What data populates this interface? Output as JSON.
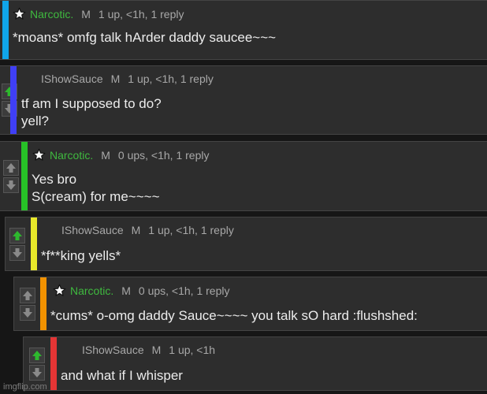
{
  "icons": {
    "upvote": "up-arrow-icon",
    "downvote": "down-arrow-icon",
    "star": "star-icon"
  },
  "colors": {
    "upvote_active": "#2eb82e",
    "upvote_inactive": "#8a8a8a",
    "downvote": "#8a8a8a",
    "username_green": "#3fb93f",
    "thread_colors": [
      "#10a5ea",
      "#3f3ff5",
      "#27c227",
      "#e8e82a",
      "#f29200",
      "#e53535"
    ]
  },
  "comments": [
    {
      "username": "Narcotic.",
      "badge": "M",
      "meta": "1 up, <1h, 1 reply",
      "lines": [
        "*moans* omfg talk hArder daddy saucee~~~"
      ]
    },
    {
      "username": "IShowSauce",
      "badge": "M",
      "meta": "1 up, <1h, 1 reply",
      "lines": [
        "tf am I supposed to do?",
        "yell?"
      ]
    },
    {
      "username": "Narcotic.",
      "badge": "M",
      "meta": "0 ups, <1h, 1 reply",
      "lines": [
        "Yes bro",
        "S(cream) for me~~~~"
      ]
    },
    {
      "username": "IShowSauce",
      "badge": "M",
      "meta": "1 up, <1h, 1 reply",
      "lines": [
        "*f**king yells*"
      ]
    },
    {
      "username": "Narcotic.",
      "badge": "M",
      "meta": "0 ups, <1h, 1 reply",
      "lines": [
        "*cums* o-omg daddy Sauce~~~~ you talk sO hard :flushshed:"
      ]
    },
    {
      "username": "IShowSauce",
      "badge": "M",
      "meta": "1 up, <1h",
      "lines": [
        "and what if I whisper"
      ]
    }
  ],
  "watermark": "imgflip.com"
}
